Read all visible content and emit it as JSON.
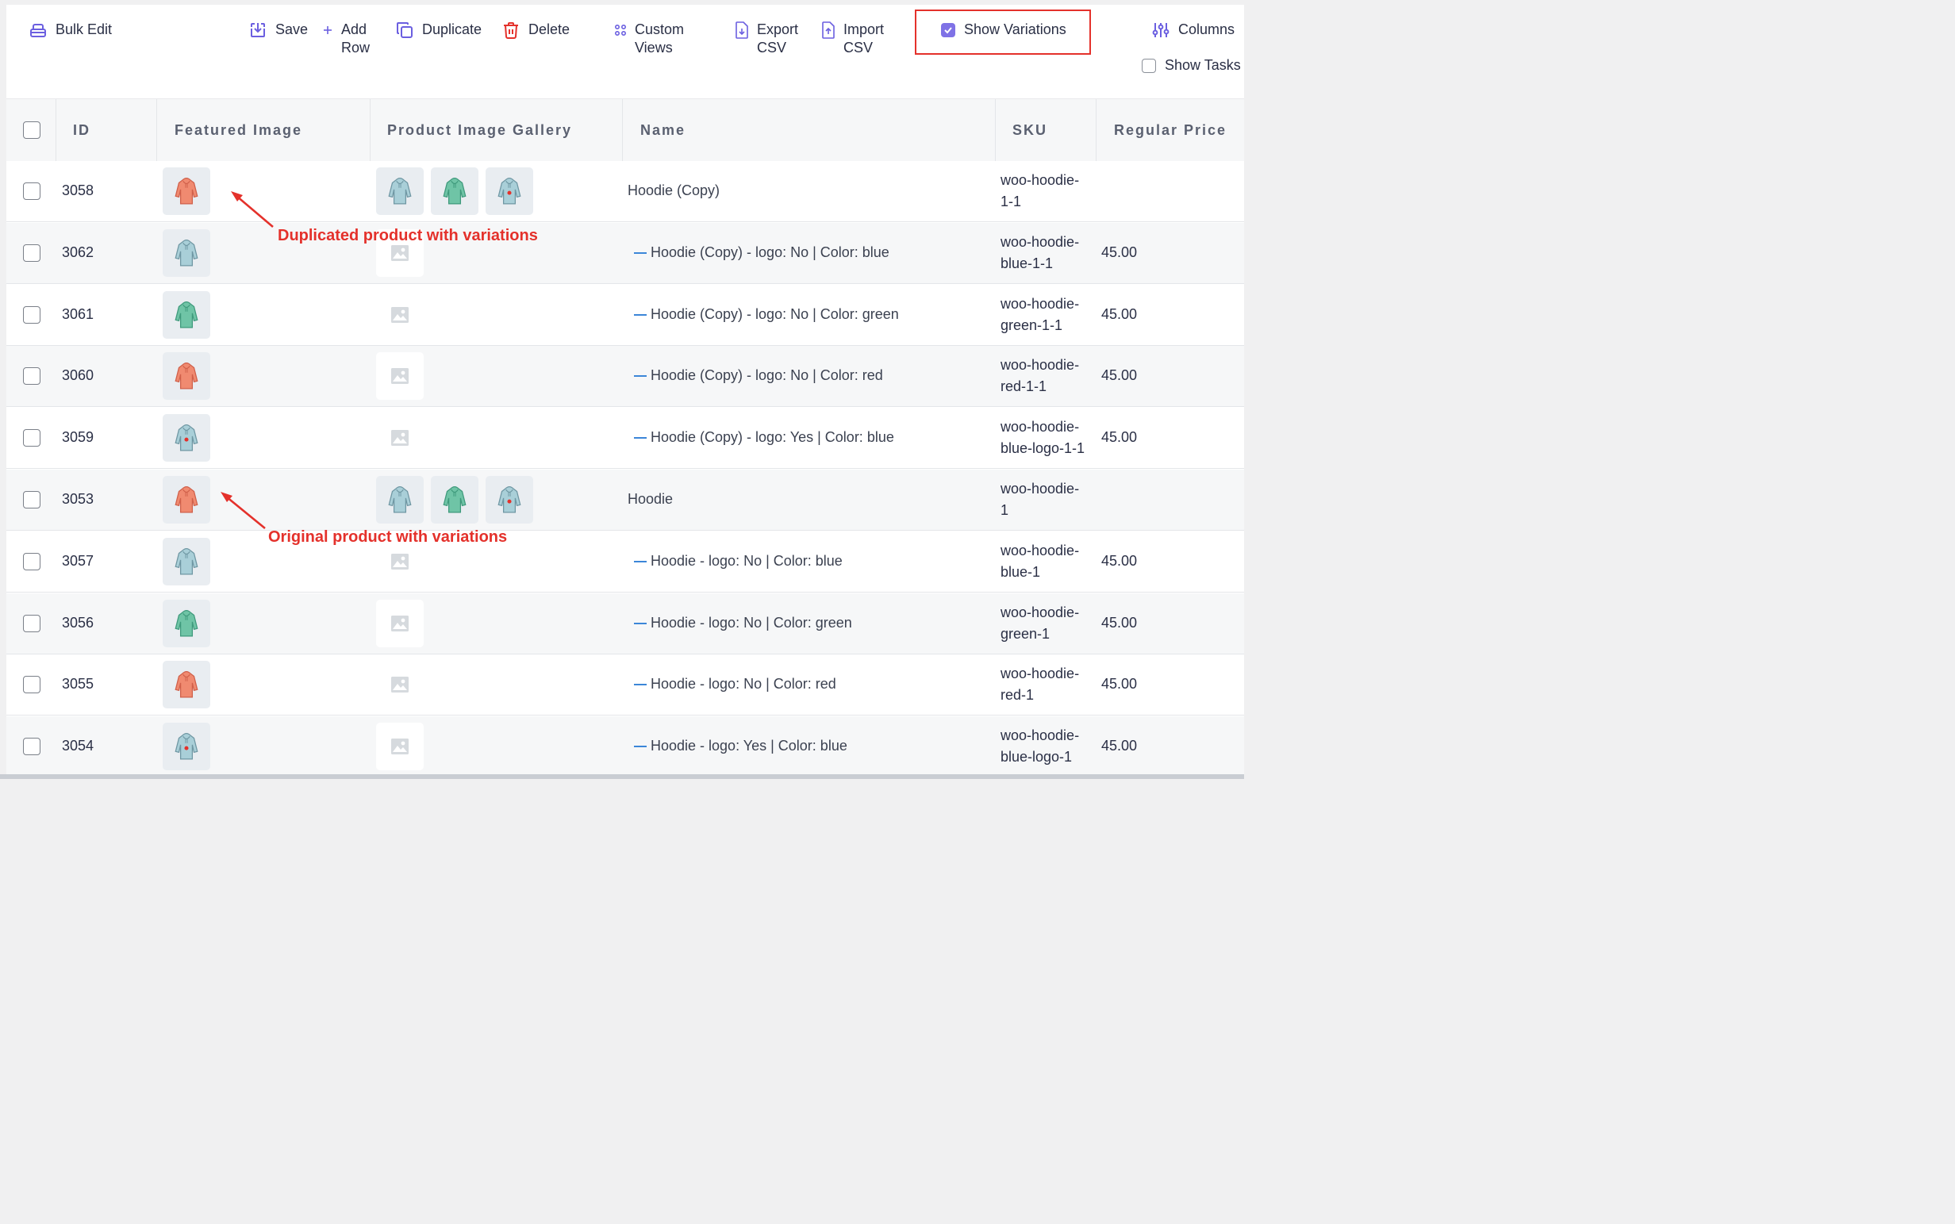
{
  "toolbar": {
    "bulk_edit": "Bulk Edit",
    "save": "Save",
    "add_row": "Add\nRow",
    "duplicate": "Duplicate",
    "delete": "Delete",
    "custom_views": "Custom\nViews",
    "export_csv": "Export\nCSV",
    "import_csv": "Import\nCSV",
    "show_variations": "Show Variations",
    "show_variations_checked": true,
    "columns": "Columns",
    "show_tasks": "Show Tasks",
    "show_tasks_checked": false
  },
  "table": {
    "headers": {
      "id": "ID",
      "featured_image": "Featured Image",
      "gallery": "Product Image Gallery",
      "name": "Name",
      "sku": "SKU",
      "regular_price": "Regular Price"
    },
    "rows": [
      {
        "id": "3058",
        "featured": "red-hoodie",
        "gallery": [
          "blue-hoodie",
          "green-hoodie",
          "logo-hoodie"
        ],
        "name": "Hoodie (Copy)",
        "variation": false,
        "sku": "woo-hoodie-\n1-1",
        "price": ""
      },
      {
        "id": "3062",
        "featured": "blue-hoodie",
        "gallery": [
          "placeholder"
        ],
        "name": "Hoodie (Copy) - logo: No | Color: blue",
        "variation": true,
        "sku": "woo-hoodie-\nblue-1-1",
        "price": "45.00"
      },
      {
        "id": "3061",
        "featured": "green-hoodie",
        "gallery": [
          "placeholder"
        ],
        "name": "Hoodie (Copy) - logo: No | Color: green",
        "variation": true,
        "sku": "woo-hoodie-\ngreen-1-1",
        "price": "45.00"
      },
      {
        "id": "3060",
        "featured": "red-hoodie",
        "gallery": [
          "placeholder"
        ],
        "name": "Hoodie (Copy) - logo: No | Color: red",
        "variation": true,
        "sku": "woo-hoodie-\nred-1-1",
        "price": "45.00"
      },
      {
        "id": "3059",
        "featured": "logo-hoodie",
        "gallery": [
          "placeholder"
        ],
        "name": "Hoodie (Copy) - logo: Yes | Color: blue",
        "variation": true,
        "sku": "woo-hoodie-\nblue-logo-1-1",
        "price": "45.00"
      },
      {
        "id": "3053",
        "featured": "red-hoodie",
        "gallery": [
          "blue-hoodie",
          "green-hoodie",
          "logo-hoodie"
        ],
        "name": "Hoodie",
        "variation": false,
        "sku": "woo-hoodie-\n1",
        "price": ""
      },
      {
        "id": "3057",
        "featured": "blue-hoodie",
        "gallery": [
          "placeholder"
        ],
        "name": "Hoodie - logo: No | Color: blue",
        "variation": true,
        "sku": "woo-hoodie-\nblue-1",
        "price": "45.00"
      },
      {
        "id": "3056",
        "featured": "green-hoodie",
        "gallery": [
          "placeholder"
        ],
        "name": "Hoodie - logo: No | Color: green",
        "variation": true,
        "sku": "woo-hoodie-\ngreen-1",
        "price": "45.00"
      },
      {
        "id": "3055",
        "featured": "red-hoodie",
        "gallery": [
          "placeholder"
        ],
        "name": "Hoodie - logo: No | Color: red",
        "variation": true,
        "sku": "woo-hoodie-\nred-1",
        "price": "45.00"
      },
      {
        "id": "3054",
        "featured": "logo-hoodie",
        "gallery": [
          "placeholder"
        ],
        "name": "Hoodie - logo: Yes | Color: blue",
        "variation": true,
        "sku": "woo-hoodie-\nblue-logo-1",
        "price": "45.00"
      }
    ]
  },
  "annotations": {
    "duplicated": "Duplicated product with variations",
    "original": "Original product with variations"
  },
  "colors": {
    "accent": "#7f72e6",
    "annotation_red": "#e4312b",
    "delete_red": "#e4312b",
    "variation_dash": "#3b86d8",
    "hoodie_red": "#f08a70",
    "hoodie_blue": "#a9cfd8",
    "hoodie_green": "#6fc4a6"
  }
}
